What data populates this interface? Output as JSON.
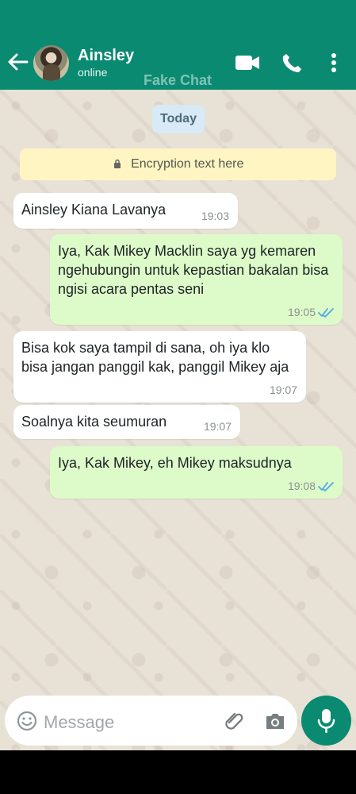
{
  "header": {
    "contact_name": "Ainsley",
    "status": "online",
    "watermark": "Fake Chat"
  },
  "chat": {
    "date_label": "Today",
    "encryption_text": "Encryption text here",
    "messages": [
      {
        "direction": "incoming",
        "text": "Ainsley Kiana Lavanya",
        "time": "19:03"
      },
      {
        "direction": "outgoing",
        "text": "Iya, Kak Mikey Macklin   saya yg kemaren ngehubungin untuk kepastian bakalan bisa ngisi acara pentas seni",
        "time": "19:05",
        "status": "read"
      },
      {
        "direction": "incoming",
        "text": "Bisa kok saya tampil di sana, oh iya klo bisa jangan panggil kak, panggil Mikey aja",
        "time": "19:07"
      },
      {
        "direction": "incoming",
        "text": "Soalnya kita seumuran",
        "time": "19:07"
      },
      {
        "direction": "outgoing",
        "text": "Iya, Kak Mikey, eh Mikey maksudnya",
        "time": "19:08",
        "status": "read"
      }
    ]
  },
  "composer": {
    "placeholder": "Message"
  },
  "icons": {
    "back": "arrow-left-icon",
    "video": "video-camera-icon",
    "phone": "phone-icon",
    "menu": "vertical-dots-icon",
    "lock": "lock-icon",
    "read": "double-check-icon",
    "emoji": "smiley-icon",
    "attach": "paperclip-icon",
    "camera": "camera-icon",
    "mic": "microphone-icon"
  },
  "colors": {
    "brand": "#0b8a72",
    "incoming_bubble": "#ffffff",
    "outgoing_bubble": "#ddfbc9",
    "read_tick": "#4fa8e8"
  }
}
